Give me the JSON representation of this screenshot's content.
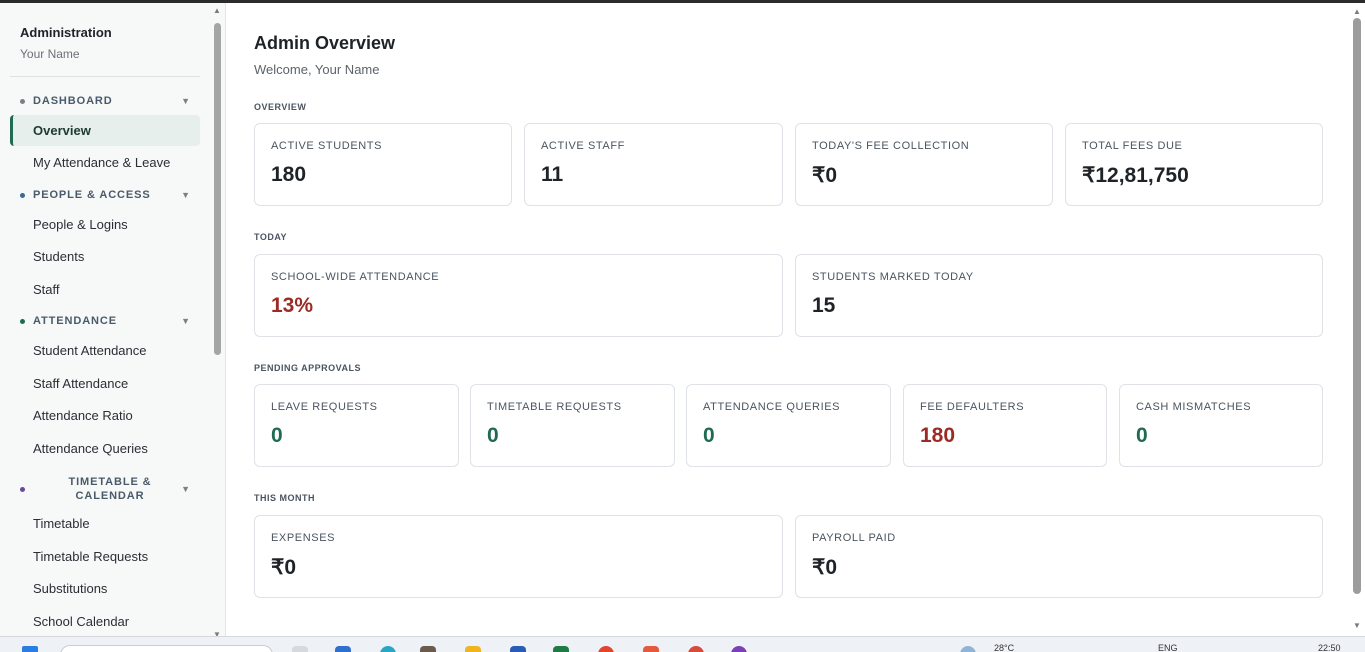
{
  "sidebar": {
    "title": "Administration",
    "user": "Your Name",
    "sections": [
      {
        "label": "DASHBOARD",
        "color": "#7a8088",
        "items": [
          "Overview",
          "My Attendance & Leave"
        ]
      },
      {
        "label": "PEOPLE & ACCESS",
        "color": "#3d6a8f",
        "items": [
          "People & Logins",
          "Students",
          "Staff"
        ]
      },
      {
        "label": "ATTENDANCE",
        "color": "#1f6b4f",
        "items": [
          "Student Attendance",
          "Staff Attendance",
          "Attendance Ratio",
          "Attendance Queries"
        ]
      },
      {
        "label": "TIMETABLE & CALENDAR",
        "color": "#6a4a9a",
        "items": [
          "Timetable",
          "Timetable Requests",
          "Substitutions",
          "School Calendar"
        ]
      }
    ],
    "active_item": "Overview"
  },
  "main": {
    "title": "Admin Overview",
    "subtitle": "Welcome, Your Name",
    "groups": {
      "overview": {
        "label": "OVERVIEW",
        "cards": [
          {
            "label": "ACTIVE STUDENTS",
            "value": "180"
          },
          {
            "label": "ACTIVE STAFF",
            "value": "11"
          },
          {
            "label": "TODAY'S FEE COLLECTION",
            "value": "₹0"
          },
          {
            "label": "TOTAL FEES DUE",
            "value": "₹12,81,750"
          }
        ]
      },
      "today": {
        "label": "TODAY",
        "cards": [
          {
            "label": "SCHOOL-WIDE ATTENDANCE",
            "value": "13%"
          },
          {
            "label": "STUDENTS MARKED TODAY",
            "value": "15"
          }
        ]
      },
      "pending": {
        "label": "PENDING APPROVALS",
        "cards": [
          {
            "label": "LEAVE REQUESTS",
            "value": "0"
          },
          {
            "label": "TIMETABLE REQUESTS",
            "value": "0"
          },
          {
            "label": "ATTENDANCE QUERIES",
            "value": "0"
          },
          {
            "label": "FEE DEFAULTERS",
            "value": "180"
          },
          {
            "label": "CASH MISMATCHES",
            "value": "0"
          }
        ]
      },
      "month": {
        "label": "THIS MONTH",
        "cards": [
          {
            "label": "EXPENSES",
            "value": "₹0"
          },
          {
            "label": "PAYROLL PAID",
            "value": "₹0"
          }
        ]
      }
    }
  },
  "colors": {
    "accent_green": "#1f6b4f",
    "alert_red": "#9b2b24"
  },
  "taskbar": {
    "weather": "28°C",
    "language": "ENG",
    "time": "22:50"
  }
}
